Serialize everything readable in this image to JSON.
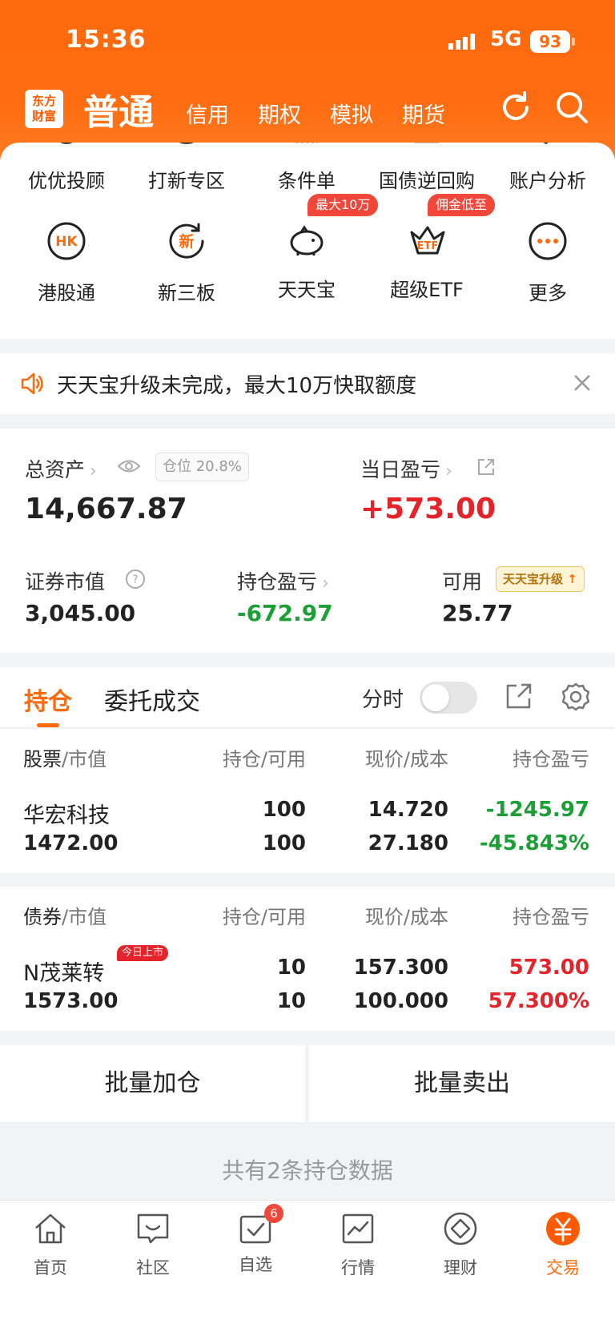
{
  "status_bar": {
    "time": "15:36",
    "network": "5G",
    "battery": "93"
  },
  "top_nav": {
    "logo_text_line1": "东方",
    "logo_text_line2": "财富",
    "main": "普通",
    "tabs": [
      "信用",
      "期权",
      "模拟",
      "期货"
    ]
  },
  "quick_grid": {
    "row1": [
      "优优投顾",
      "打新专区",
      "条件单",
      "国债逆回购",
      "账户分析"
    ],
    "row2": [
      {
        "label": "港股通",
        "icon": "hk-icon",
        "icon_text": "HK"
      },
      {
        "label": "新三板",
        "icon": "new-board-icon",
        "icon_text": "新"
      },
      {
        "label": "天天宝",
        "icon": "piggy-bank-icon",
        "badge": "最大10万"
      },
      {
        "label": "超级ETF",
        "icon": "etf-icon",
        "icon_text": "ETF",
        "badge": "佣金低至"
      },
      {
        "label": "更多",
        "icon": "more-icon"
      }
    ]
  },
  "notice": {
    "text": "天天宝升级未完成，最大10万快取额度"
  },
  "assets": {
    "total_label": "总资产",
    "position_badge": "仓位 20.8%",
    "total_value": "14,667.87",
    "daily_pnl_label": "当日盈亏",
    "daily_pnl_value": "+573.00",
    "market_value_label": "证券市值",
    "market_value": "3,045.00",
    "hold_pnl_label": "持仓盈亏",
    "hold_pnl_value": "-672.97",
    "available_label": "可用",
    "available_value": "25.77",
    "upgrade_tag": "天天宝升级"
  },
  "holdings_tabs": {
    "active": "持仓",
    "other": "委托成交",
    "fenshi": "分时"
  },
  "stock_section": {
    "col1_main": "股票",
    "col1_sub": "/市值",
    "col2": "持仓/可用",
    "col3": "现价/成本",
    "col4": "持仓盈亏",
    "rows": [
      {
        "name": "华宏科技",
        "market_value": "1472.00",
        "position": "100",
        "available": "100",
        "price": "14.720",
        "cost": "27.180",
        "pnl": "-1245.97",
        "pnl_pct": "-45.843%"
      }
    ]
  },
  "bond_section": {
    "col1_main": "债券",
    "col1_sub": "/市值",
    "col2": "持仓/可用",
    "col3": "现价/成本",
    "col4": "持仓盈亏",
    "rows": [
      {
        "name": "N茂莱转",
        "tag": "今日上市",
        "market_value": "1573.00",
        "position": "10",
        "available": "10",
        "price": "157.300",
        "cost": "100.000",
        "pnl": "573.00",
        "pnl_pct": "57.300%"
      }
    ]
  },
  "batch": {
    "add": "批量加仓",
    "sell": "批量卖出"
  },
  "footer_note": "共有2条持仓数据",
  "tabbar": [
    {
      "label": "首页",
      "icon": "home-icon"
    },
    {
      "label": "社区",
      "icon": "community-icon"
    },
    {
      "label": "自选",
      "icon": "watchlist-icon",
      "count": "6"
    },
    {
      "label": "行情",
      "icon": "market-icon"
    },
    {
      "label": "理财",
      "icon": "wealth-icon"
    },
    {
      "label": "交易",
      "icon": "trade-icon",
      "active": true
    }
  ],
  "colors": {
    "accent": "#ff6a0c",
    "up": "#e4232a",
    "down": "#1aa035"
  }
}
